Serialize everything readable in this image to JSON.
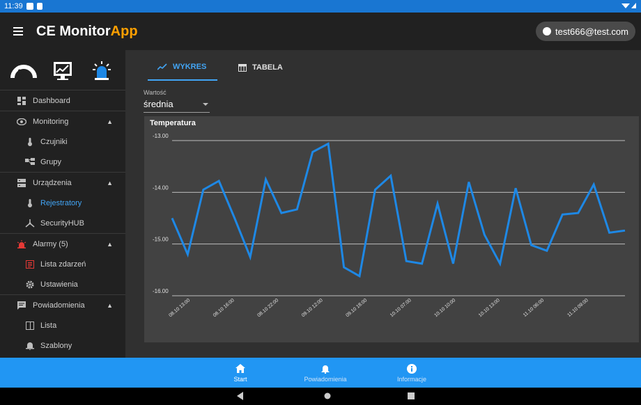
{
  "status_bar": {
    "time": "11:39"
  },
  "app": {
    "title_main": "CE Monitor",
    "title_accent": "App",
    "user_email": "test666@test.com"
  },
  "sidebar": {
    "items": [
      {
        "label": "Dashboard",
        "icon": "dashboard-icon",
        "level": 0
      },
      {
        "label": "Monitoring",
        "icon": "eye-icon",
        "level": 0,
        "expanded": true
      },
      {
        "label": "Czujniki",
        "icon": "thermometer-icon",
        "level": 1
      },
      {
        "label": "Grupy",
        "icon": "groups-icon",
        "level": 1
      },
      {
        "label": "Urządzenia",
        "icon": "devices-icon",
        "level": 0,
        "expanded": true
      },
      {
        "label": "Rejestratory",
        "icon": "thermometer-icon",
        "level": 1,
        "active": true
      },
      {
        "label": "SecurityHUB",
        "icon": "hub-icon",
        "level": 1
      },
      {
        "label": "Alarmy (5)",
        "icon": "alarm-icon",
        "level": 0,
        "expanded": true
      },
      {
        "label": "Lista zdarzeń",
        "icon": "event-list-icon",
        "level": 1
      },
      {
        "label": "Ustawienia",
        "icon": "gear-icon",
        "level": 1
      },
      {
        "label": "Powiadomienia",
        "icon": "message-icon",
        "level": 0,
        "expanded": true
      },
      {
        "label": "Lista",
        "icon": "list-icon",
        "level": 1
      },
      {
        "label": "Szablony",
        "icon": "template-icon",
        "level": 1
      }
    ]
  },
  "tabs": {
    "wykres": "WYKRES",
    "tabela": "TABELA"
  },
  "select": {
    "label": "Wartość",
    "value": "średnia"
  },
  "chart_data": {
    "type": "line",
    "title": "Temperatura",
    "ylim": [
      -16.0,
      -13.0
    ],
    "yticks": [
      "-13.00",
      "-14.00",
      "-15.00",
      "-16.00"
    ],
    "xticks": [
      "08.10 13:00",
      "08.10 16:00",
      "08.10 22:00",
      "09.10 12:00",
      "09.10 18:00",
      "10.10 07:00",
      "10.10 10:00",
      "10.10 13:00",
      "11.10 06:00",
      "11.10 09:00"
    ],
    "series": [
      {
        "color": "#1e88e5",
        "values": [
          -14.5,
          -15.2,
          -13.95,
          -13.78,
          -14.5,
          -15.25,
          -13.75,
          -14.4,
          -14.33,
          -13.22,
          -13.06,
          -15.45,
          -15.62,
          -13.95,
          -13.68,
          -15.33,
          -15.38,
          -14.22,
          -15.38,
          -13.8,
          -14.82,
          -15.38,
          -13.92,
          -15.02,
          -15.13,
          -14.43,
          -14.4,
          -13.85,
          -14.78,
          -14.74
        ]
      }
    ],
    "grid": true,
    "legend": "none"
  },
  "bottom_nav": {
    "items": [
      {
        "label": "Start",
        "icon": "home-icon",
        "active": true
      },
      {
        "label": "Powiadomienia",
        "icon": "bell-icon"
      },
      {
        "label": "Informacje",
        "icon": "info-icon"
      }
    ]
  },
  "colors": {
    "accent": "#ffa000",
    "primary": "#2196f3",
    "line": "#1e88e5",
    "active_text": "#42a5f5",
    "alarm": "#e53935"
  }
}
